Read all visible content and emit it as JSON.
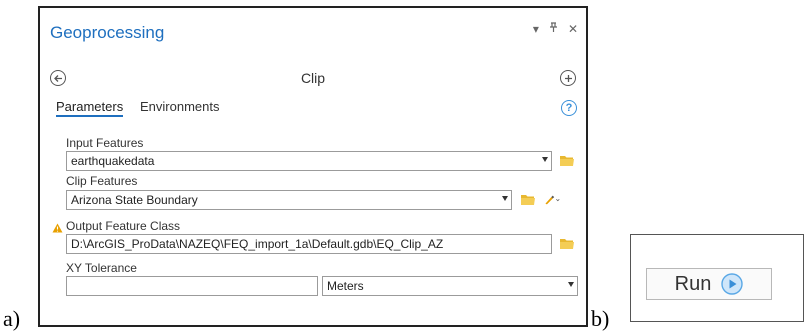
{
  "captions": {
    "a": "a)",
    "b": "b)"
  },
  "panel": {
    "title": "Geoprocessing",
    "window_controls": {
      "dropdown": "▾",
      "pin": "ᵖ",
      "close": "✕"
    },
    "tool_name": "Clip",
    "tabs": [
      {
        "label": "Parameters",
        "active": true
      },
      {
        "label": "Environments",
        "active": false
      }
    ],
    "params": {
      "input_features": {
        "label": "Input Features",
        "value": "earthquakedata"
      },
      "clip_features": {
        "label": "Clip Features",
        "value": "Arizona State Boundary"
      },
      "output_feature_class": {
        "label": "Output Feature Class",
        "value": "D:\\ArcGIS_ProData\\NAZEQ\\FEQ_import_1a\\Default.gdb\\EQ_Clip_AZ"
      },
      "xy_tolerance": {
        "label": "XY Tolerance",
        "value": "",
        "unit": "Meters"
      }
    }
  },
  "run": {
    "label": "Run"
  },
  "colors": {
    "accent": "#1e6fbf",
    "folder": "#f0c040",
    "warning": "#e8a000",
    "run_icon": "#5aa8e6"
  }
}
